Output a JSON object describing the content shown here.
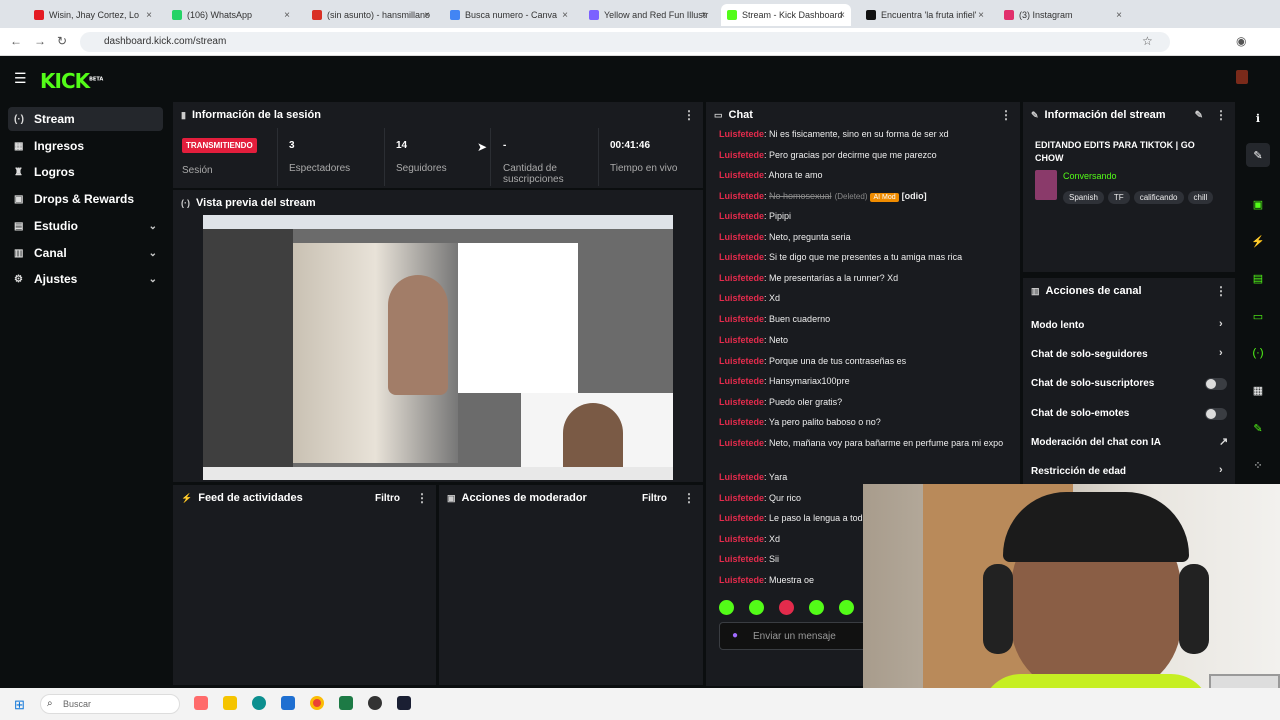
{
  "browser": {
    "tabs": [
      {
        "label": "Wisin, Jhay Cortez, Lo",
        "color": "#e41b23"
      },
      {
        "label": "(106) WhatsApp",
        "color": "#25d366"
      },
      {
        "label": "(sin asunto) - hansmillano",
        "color": "#d93025"
      },
      {
        "label": "Busca numero - Canva",
        "color": "#4285f4"
      },
      {
        "label": "Yellow and Red Fun Illustr",
        "color": "#7b61ff"
      },
      {
        "label": "Stream - Kick Dashboard",
        "color": "#53fc18"
      },
      {
        "label": "Encuentra 'la fruta infiel'",
        "color": "#111111"
      },
      {
        "label": "(3) Instagram",
        "color": "#e1306c"
      }
    ],
    "url": "dashboard.kick.com/stream"
  },
  "app": {
    "logo": "KICK",
    "beta": "BETA"
  },
  "sidebar": {
    "items": [
      {
        "label": "Stream",
        "icon": "broadcast-icon",
        "glyph": "(·)"
      },
      {
        "label": "Ingresos",
        "icon": "money-icon",
        "glyph": "▦"
      },
      {
        "label": "Logros",
        "icon": "trophy-icon",
        "glyph": "♜"
      },
      {
        "label": "Drops & Rewards",
        "icon": "gift-icon",
        "glyph": "▣"
      },
      {
        "label": "Estudio",
        "icon": "studio-icon",
        "glyph": "▤"
      },
      {
        "label": "Canal",
        "icon": "channel-icon",
        "glyph": "▥"
      },
      {
        "label": "Ajustes",
        "icon": "gear-icon",
        "glyph": "⚙"
      }
    ]
  },
  "session": {
    "title": "Información de la sesión",
    "status_badge": "TRANSMITIENDO",
    "status_label": "Sesión",
    "viewers_value": "3",
    "viewers_label": "Espectadores",
    "followers_value": "14",
    "followers_label": "Seguidores",
    "subs_value": "-",
    "subs_label": "Cantidad de suscripciones",
    "time_value": "00:41:46",
    "time_label": "Tiempo en vivo"
  },
  "preview": {
    "title": "Vista previa del stream"
  },
  "activity": {
    "title": "Feed de actividades",
    "filter": "Filtro"
  },
  "mod": {
    "title": "Acciones de moderador",
    "filter": "Filtro"
  },
  "chat": {
    "title": "Chat",
    "messages": [
      {
        "user": "Luisfetede",
        "text": "Ni es fisicamente, sino en su forma de ser xd"
      },
      {
        "user": "Luisfetede",
        "text": "Pero gracias por decirme que me parezco"
      },
      {
        "user": "Luisfetede",
        "text": "Ahora te amo"
      },
      {
        "user": "Luisfetede",
        "text": "No homosexual",
        "deleted": "(Deleted)",
        "badge": "AI Mod",
        "tag": "[odio]"
      },
      {
        "user": "Luisfetede",
        "text": "Pipipi"
      },
      {
        "user": "Luisfetede",
        "text": "Neto, pregunta seria"
      },
      {
        "user": "Luisfetede",
        "text": "Si te digo que me presentes a tu amiga mas rica"
      },
      {
        "user": "Luisfetede",
        "text": "Me presentarías a la runner? Xd"
      },
      {
        "user": "Luisfetede",
        "text": "Xd"
      },
      {
        "user": "Luisfetede",
        "text": "Buen cuaderno"
      },
      {
        "user": "Luisfetede",
        "text": "Neto"
      },
      {
        "user": "Luisfetede",
        "text": "Porque una de tus contraseñas es"
      },
      {
        "user": "Luisfetede",
        "text": "Hansymariax100pre"
      },
      {
        "user": "Luisfetede",
        "text": "Puedo oler gratis?"
      },
      {
        "user": "Luisfetede",
        "text": "Ya pero palito baboso o no?"
      },
      {
        "user": "Luisfetede",
        "text": "Neto, mañana voy para bañarme en perfume para mi expo"
      },
      {
        "user": "Luisfetede",
        "text": "Yara"
      },
      {
        "user": "Luisfetede",
        "text": "Qur rico"
      },
      {
        "user": "Luisfetede",
        "text": "Le paso la lengua a tod"
      },
      {
        "user": "Luisfetede",
        "text": "Xd"
      },
      {
        "user": "Luisfetede",
        "text": "Sii"
      },
      {
        "user": "Luisfetede",
        "text": "Muestra oe"
      }
    ],
    "input_placeholder": "Enviar un mensaje"
  },
  "stream_info": {
    "title": "Información del stream",
    "stream_title": "EDITANDO EDITS PARA TIKTOK | GO CHOW",
    "category": "Conversando",
    "tags": [
      "Spanish",
      "TF",
      "calificando",
      "chill"
    ]
  },
  "channel_actions": {
    "title": "Acciones de canal",
    "items": [
      {
        "label": "Modo lento",
        "control": "chevron"
      },
      {
        "label": "Chat de solo-seguidores",
        "control": "chevron"
      },
      {
        "label": "Chat de solo-suscriptores",
        "control": "toggle"
      },
      {
        "label": "Chat de solo-emotes",
        "control": "toggle"
      },
      {
        "label": "Moderación del chat con IA",
        "control": "external"
      },
      {
        "label": "Restricción de edad",
        "control": "chevron"
      }
    ]
  },
  "taskbar": {
    "search_placeholder": "Buscar"
  },
  "colors": {
    "accent": "#53fc18",
    "live": "#e31e3c",
    "username": "#e32b4c"
  }
}
